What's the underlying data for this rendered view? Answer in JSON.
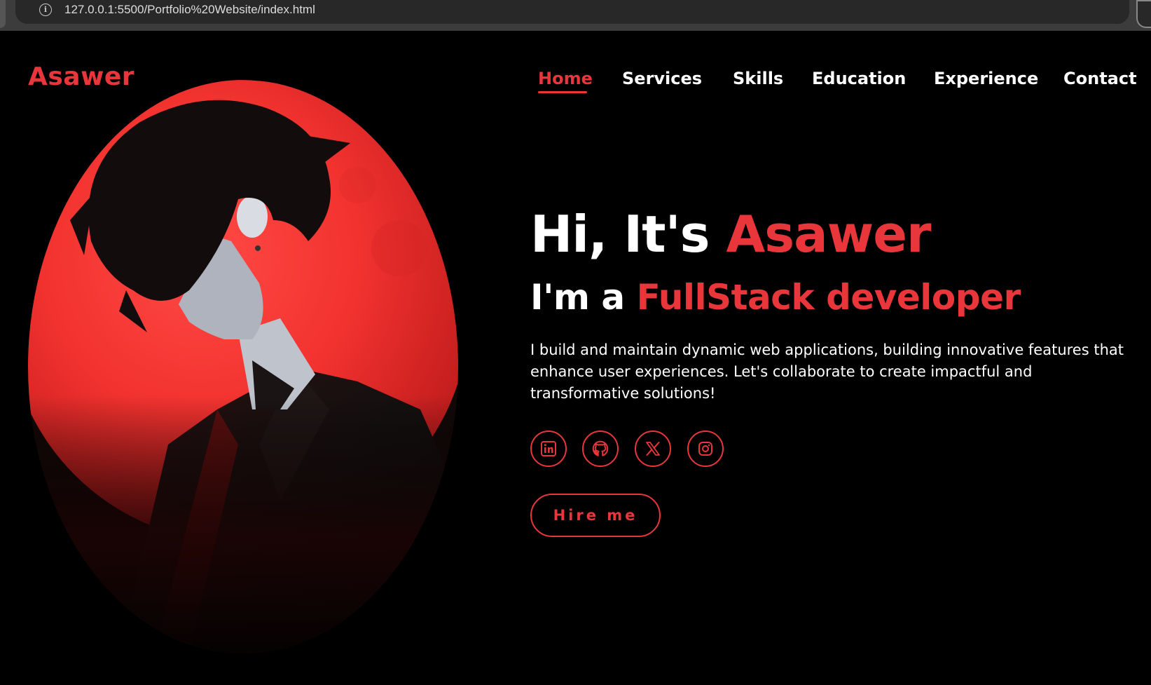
{
  "browser": {
    "url": "127.0.0.1:5500/Portfolio%20Website/index.html"
  },
  "header": {
    "logo": "Asawer",
    "nav": [
      {
        "label": "Home",
        "active": true
      },
      {
        "label": "Services",
        "active": false
      },
      {
        "label": "Skills",
        "active": false
      },
      {
        "label": "Education",
        "active": false
      },
      {
        "label": "Experience",
        "active": false
      },
      {
        "label": "Contact",
        "active": false
      }
    ]
  },
  "hero": {
    "greeting": "Hi, It's",
    "name": "Asawer",
    "role_prefix": "I'm a",
    "role": "FullStack developer",
    "description": "I build and maintain dynamic web applications, building innovative features that enhance user experiences. Let's collaborate to create impactful and transformative solutions!",
    "socials": [
      {
        "icon": "linkedin-icon"
      },
      {
        "icon": "github-icon"
      },
      {
        "icon": "x-icon"
      },
      {
        "icon": "instagram-icon"
      }
    ],
    "cta": "Hire me",
    "image_icon": "portrait-illustration"
  },
  "colors": {
    "accent": "#e8363b",
    "background": "#000000",
    "text": "#ffffff"
  }
}
